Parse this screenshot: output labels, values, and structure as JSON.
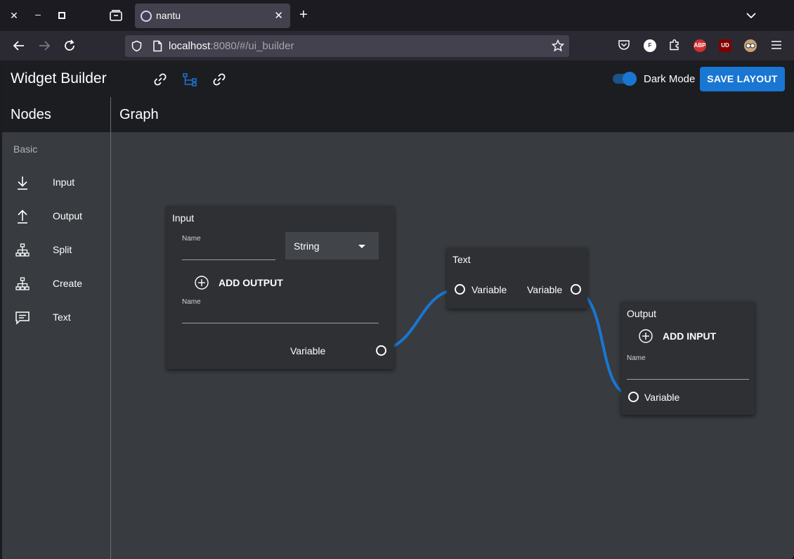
{
  "browser": {
    "tab_title": "nantu",
    "url_host": "localhost",
    "url_rest": ":8080/#/ui_builder",
    "extensions": {
      "abp": "ABP",
      "ublock": "UD",
      "f": "F"
    }
  },
  "app": {
    "title": "Widget Builder",
    "dark_mode_label": "Dark Mode",
    "dark_mode_on": true,
    "save_label": "SAVE LAYOUT",
    "accent": "#1976d2"
  },
  "sidebar": {
    "header": "Nodes",
    "section": "Basic",
    "items": [
      {
        "label": "Input",
        "icon": "download-icon"
      },
      {
        "label": "Output",
        "icon": "upload-icon"
      },
      {
        "label": "Split",
        "icon": "hierarchy-icon"
      },
      {
        "label": "Create",
        "icon": "hierarchy-icon"
      },
      {
        "label": "Text",
        "icon": "comment-icon"
      }
    ]
  },
  "graph": {
    "header": "Graph",
    "nodes": {
      "input": {
        "title": "Input",
        "name_label": "Name",
        "name_value": "",
        "type_value": "String",
        "add_output_label": "ADD OUTPUT",
        "output_name_label": "Name",
        "output_name_value": "",
        "port_label": "Variable"
      },
      "text": {
        "title": "Text",
        "in_label": "Variable",
        "out_label": "Variable"
      },
      "output": {
        "title": "Output",
        "add_input_label": "ADD INPUT",
        "name_label": "Name",
        "name_value": "",
        "port_label": "Variable"
      }
    }
  }
}
